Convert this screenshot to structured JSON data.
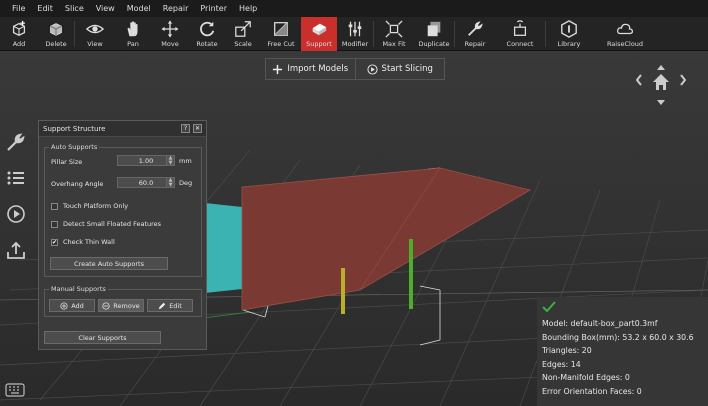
{
  "menu": [
    "File",
    "Edit",
    "Slice",
    "View",
    "Model",
    "Repair",
    "Printer",
    "Help"
  ],
  "toolbar": {
    "items": [
      {
        "label": "Add",
        "icon": "add-box-icon"
      },
      {
        "label": "Delete",
        "icon": "delete-box-icon"
      },
      {
        "label": "View",
        "icon": "eye-icon"
      },
      {
        "label": "Pan",
        "icon": "hand-icon"
      },
      {
        "label": "Move",
        "icon": "move-arrows-icon"
      },
      {
        "label": "Rotate",
        "icon": "rotate-icon"
      },
      {
        "label": "Scale",
        "icon": "scale-icon"
      },
      {
        "label": "Free Cut",
        "icon": "cut-icon"
      },
      {
        "label": "Support",
        "icon": "support-icon",
        "active": true
      },
      {
        "label": "Modifier",
        "icon": "sliders-icon"
      },
      {
        "label": "Max Fit",
        "icon": "max-fit-icon"
      },
      {
        "label": "Duplicate",
        "icon": "duplicate-icon"
      },
      {
        "label": "Repair",
        "icon": "wrench-icon"
      },
      {
        "label": "Connect",
        "icon": "connect-icon"
      },
      {
        "label": "Library",
        "icon": "library-icon"
      },
      {
        "label": "RaiseCloud",
        "icon": "cloud-icon"
      }
    ],
    "active_color": "#c9302c"
  },
  "slicebar": {
    "import_label": "Import Models",
    "slice_label": "Start Slicing"
  },
  "support_panel": {
    "title": "Support Structure",
    "help_btn": "?",
    "close_btn": "✕",
    "auto_group": "Auto Supports",
    "pillar_label": "Pillar Size",
    "pillar_value": "1.00",
    "pillar_unit": "mm",
    "overhang_label": "Overhang Angle",
    "overhang_value": "60.0",
    "overhang_unit": "Deg",
    "touch_platform": {
      "label": "Touch Platform Only",
      "checked": false
    },
    "detect_small": {
      "label": "Detect Small Floated Features",
      "checked": false
    },
    "check_thin": {
      "label": "Check Thin Wall",
      "checked": true
    },
    "create_btn": "Create Auto Supports",
    "manual_group": "Manual Supports",
    "add_btn": "Add",
    "remove_btn": "Remove",
    "edit_btn": "Edit",
    "clear_btn": "Clear Supports"
  },
  "info": {
    "model": "Model: default-box_part0.3mf",
    "bbox": "Bounding Box(mm): 53.2 x 60.0 x 30.6",
    "triangles": "Triangles: 20",
    "edges": "Edges: 14",
    "non_manifold": "Non-Manifold Edges: 0",
    "orientation": "Error Orientation Faces: 0",
    "ok_color": "#3cb043"
  },
  "colors": {
    "model_face": "#7a3a33",
    "platform_face": "#3bb3b3",
    "support_green": "#4caf2a",
    "support_yellow": "#b8b02a"
  }
}
